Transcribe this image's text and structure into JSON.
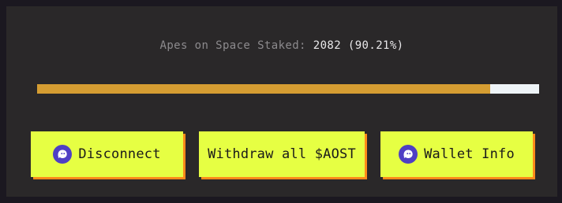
{
  "stats": {
    "label": "Apes on Space Staked:",
    "value": "2082 (90.21%)"
  },
  "progress": {
    "fraction": 0.9021
  },
  "buttons": {
    "disconnect": {
      "label": "Disconnect",
      "icon": "ghost-wallet-icon"
    },
    "withdraw": {
      "label": "Withdraw all $AOST"
    },
    "wallet_info": {
      "label": "Wallet Info",
      "icon": "ghost-wallet-icon"
    }
  },
  "colors": {
    "background": "#1b1820",
    "panel": "#2a2829",
    "button": "#e6ff43",
    "button_shadow": "#ff8a1a",
    "progress_fill": "#d59d32",
    "progress_track": "#eef4f7",
    "icon": "#4f3fc4"
  }
}
